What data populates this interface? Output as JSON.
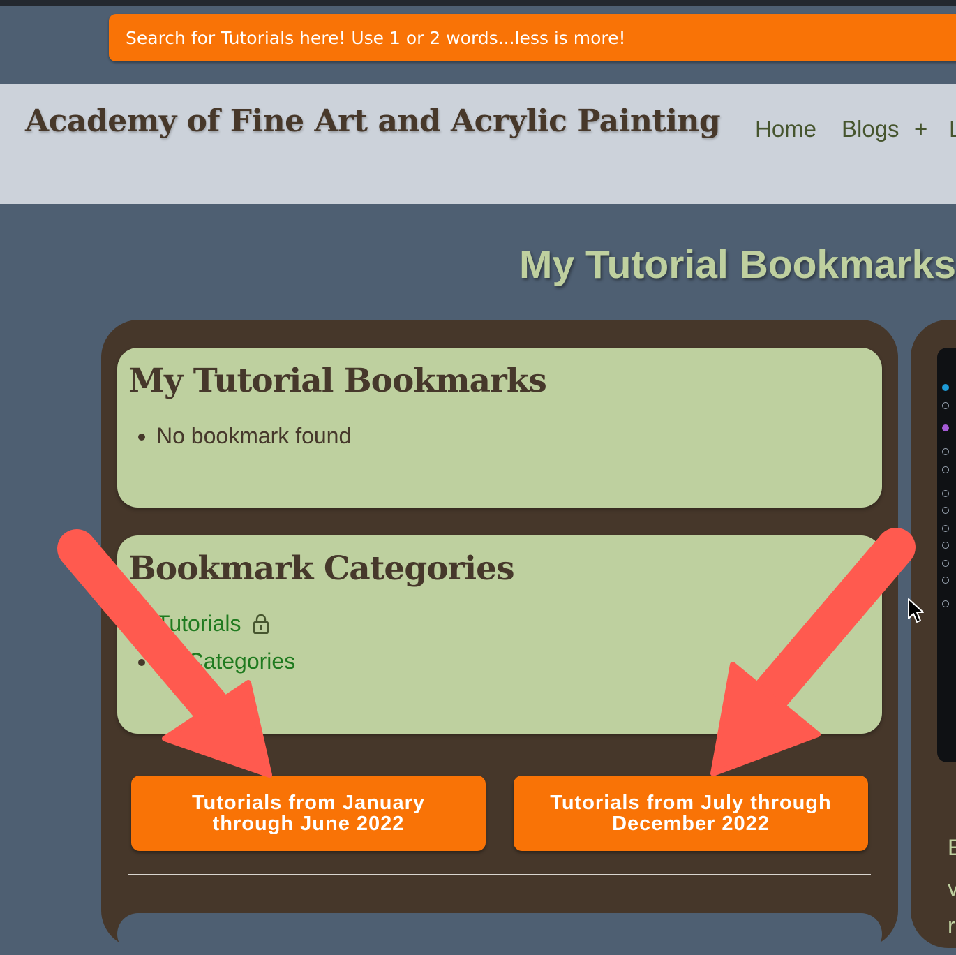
{
  "search": {
    "placeholder": "Search for Tutorials here! Use 1 or 2 words...less is more!"
  },
  "site": {
    "title": "Academy of Fine Art and Acrylic Painting"
  },
  "nav": {
    "items": [
      "Home",
      "Blogs",
      "+",
      "L"
    ]
  },
  "page": {
    "title": "My Tutorial Bookmarks a"
  },
  "bookmarks": {
    "heading": "My Tutorial Bookmarks",
    "empty_text": "No bookmark found"
  },
  "categories": {
    "heading": "Bookmark Categories",
    "items": [
      "Tutorials",
      "All Categories"
    ]
  },
  "buttons": {
    "jan_june": "Tutorials from January through June 2022",
    "july_dec": "Tutorials from July through December 2022"
  },
  "side_text": [
    "E",
    "v",
    "r"
  ],
  "colors": {
    "accent_orange": "#f97306",
    "panel_brown": "#46372a",
    "card_green": "#bed09f",
    "background": "#4e5f72",
    "arrow_red": "#ff5a4f"
  },
  "icons": [
    "lock-icon",
    "arrow-annotation",
    "mouse-cursor-icon"
  ]
}
